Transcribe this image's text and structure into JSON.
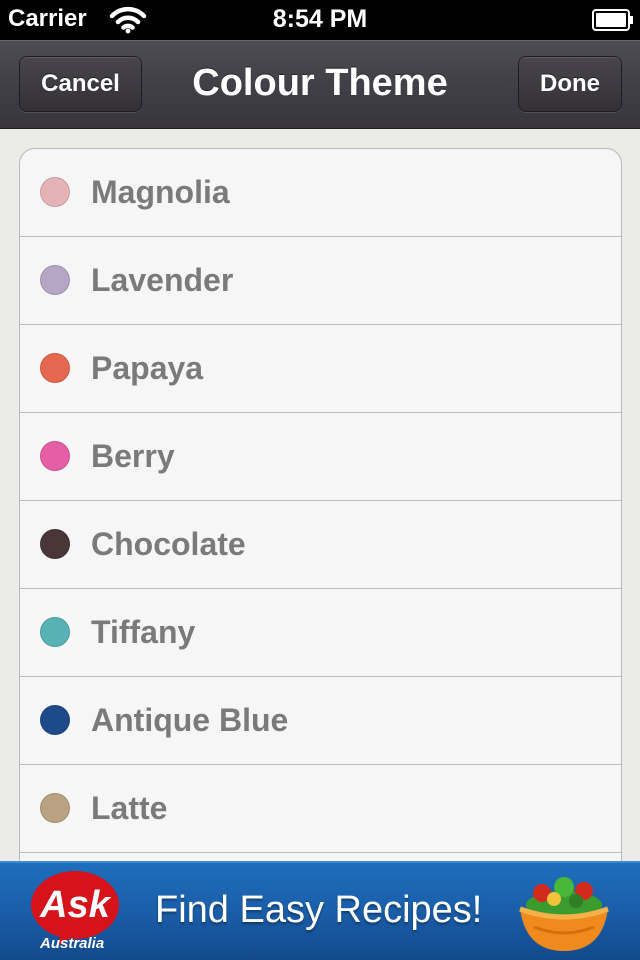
{
  "status_bar": {
    "carrier": "Carrier",
    "time": "8:54 PM"
  },
  "nav": {
    "title": "Colour Theme",
    "cancel_label": "Cancel",
    "done_label": "Done"
  },
  "themes": [
    {
      "name": "Magnolia",
      "color": "#e5b3b5"
    },
    {
      "name": "Lavender",
      "color": "#b5a6c6"
    },
    {
      "name": "Papaya",
      "color": "#e5674f"
    },
    {
      "name": "Berry",
      "color": "#e55ea6"
    },
    {
      "name": "Chocolate",
      "color": "#4a3636"
    },
    {
      "name": "Tiffany",
      "color": "#58b1b5"
    },
    {
      "name": "Antique Blue",
      "color": "#1f4a8a"
    },
    {
      "name": "Latte",
      "color": "#b9a181"
    }
  ],
  "ad": {
    "logo_text": "Ask",
    "logo_subtext": "Australia",
    "headline": "Find Easy Recipes!"
  }
}
